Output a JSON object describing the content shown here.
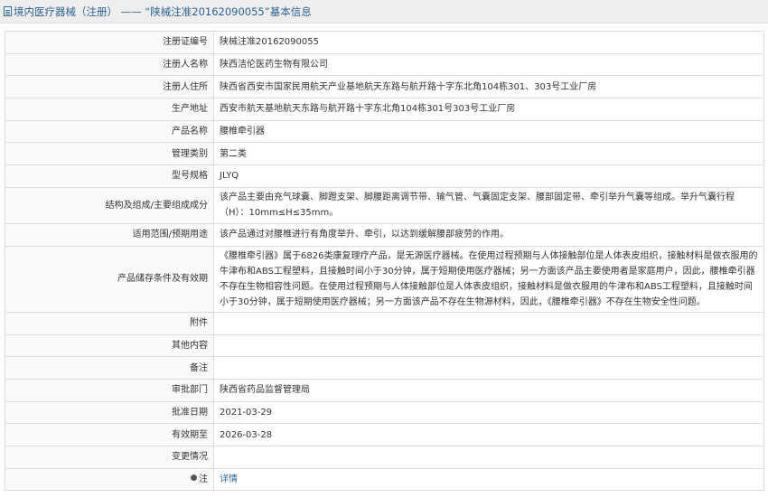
{
  "header": {
    "title": "境内医疗器械（注册） —— “陕械注准20162090055”基本信息"
  },
  "rows": [
    {
      "label": "注册证编号",
      "value": "陕械注准20162090055"
    },
    {
      "label": "注册人名称",
      "value": "陕西洁伦医药生物有限公司"
    },
    {
      "label": "注册人住所",
      "value": "陕西省西安市国家民用航天产业基地航天东路与航开路十字东北角104栋301、303号工业厂房"
    },
    {
      "label": "生产地址",
      "value": "西安市航天基地航天东路与航开路十字东北角104栋301号303号工业厂房"
    },
    {
      "label": "产品名称",
      "value": "腰椎牵引器"
    },
    {
      "label": "管理类别",
      "value": "第二类"
    },
    {
      "label": "型号规格",
      "value": "JLYQ"
    },
    {
      "label": "结构及组成/主要组成成分",
      "value": "该产品主要由充气球囊、脚蹬支架、脚腰距离调节带、输气管、气囊固定支架、腰部固定带、牵引举升气囊等组成。举升气囊行程（H）：10mm≤H≤35mm。"
    },
    {
      "label": "适用范围/预期用途",
      "value": "该产品通过对腰椎进行有角度举升、牵引，以达到缓解腰部疲劳的作用。"
    },
    {
      "label": "产品储存条件及有效期",
      "value": "《腰椎牵引器》属于6826类康复理疗产品，是无源医疗器械。在使用过程预期与人体接触部位是人体表皮组织，接触材料是做衣服用的牛津布和ABS工程塑料，且接触时间小于30分钟，属于短期使用医疗器械；另一方面该产品主要使用者是家庭用户，因此，腰椎牵引器不存在生物相容性问题。在使用过程预期与人体接触部位是人体表皮组织，接触材料是做衣服用的牛津布和ABS工程塑料，且接触时间小于30分钟，属于短期使用医疗器械；另一方面该产品不存在生物源材料，因此，《腰椎牵引器》不存在生物安全性问题。"
    },
    {
      "label": "附件",
      "value": ""
    },
    {
      "label": "其他内容",
      "value": ""
    },
    {
      "label": "备注",
      "value": ""
    },
    {
      "label": "审批部门",
      "value": "陕西省药品监督管理局"
    },
    {
      "label": "批准日期",
      "value": "2021-03-29"
    },
    {
      "label": "有效期至",
      "value": "2026-03-28"
    },
    {
      "label": "变更情况",
      "value": ""
    }
  ],
  "note": {
    "label": "注",
    "link": "详情",
    "icon": "pin-icon"
  }
}
